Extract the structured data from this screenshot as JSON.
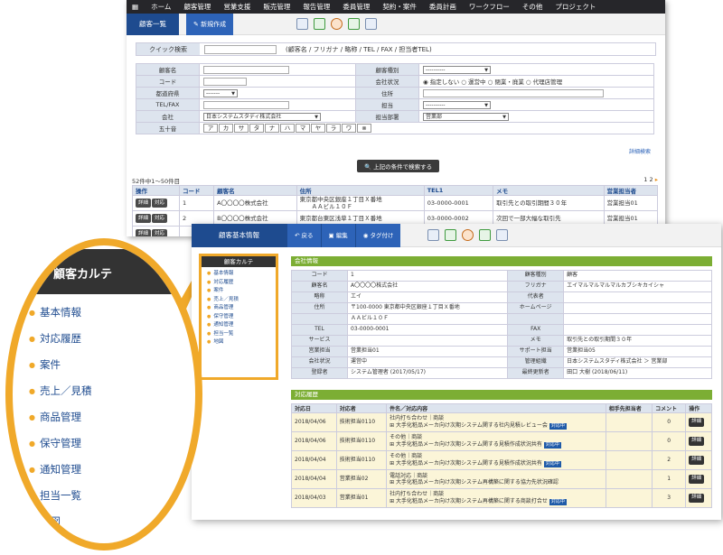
{
  "nav": [
    "ホーム",
    "顧客管理",
    "営業支援",
    "販売管理",
    "報告管理",
    "委員管理",
    "契約・案件",
    "委員計画",
    "ワークフロー",
    "その他",
    "プロジェクト"
  ],
  "list": {
    "title": "顧客一覧",
    "new_label": "新規作成",
    "quick": {
      "label": "クイック検索",
      "hint": "(顧客名 / フリガナ / 略称 / TEL / FAX / 担当者TEL)"
    },
    "form": {
      "name": "顧客名",
      "type": "顧客種別",
      "type_val": "----------",
      "code": "コード",
      "status": "会社状況",
      "status_opts": [
        "指定しない",
        "運営中",
        "閉業・廃業",
        "代理店管理"
      ],
      "pref": "都道府県",
      "pref_val": "-------",
      "addr": "住所",
      "telfax": "TEL/FAX",
      "rep": "担当",
      "rep_val": "----------",
      "company": "会社",
      "company_val": "日本システムスタディ株式会社",
      "dept": "担当部署",
      "dept_val": "営業部",
      "gojuon": "五十音",
      "kana": [
        "ア",
        "カ",
        "サ",
        "タ",
        "ナ",
        "ハ",
        "マ",
        "ヤ",
        "ラ",
        "ワ"
      ]
    },
    "detail_search": "詳細検索",
    "search_btn": "上記の条件で検索する",
    "count": "52件中1～50件目",
    "pages": [
      "1",
      "2"
    ],
    "cols": [
      "操作",
      "コード",
      "顧客名",
      "住所",
      "TEL1",
      "メモ",
      "営業担当者"
    ],
    "btn_detail": "詳細",
    "btn_resp": "対応",
    "rows": [
      {
        "code": "1",
        "name": "A〇〇〇〇株式会社",
        "addr1": "東京都中央区銀座１丁目Ｘ番地",
        "addr2": "ＡＡビル１０Ｆ",
        "tel": "03-0000-0001",
        "memo": "取引先との取引期間３０年",
        "rep": "営業担当01"
      },
      {
        "code": "2",
        "name": "B〇〇〇〇株式会社",
        "addr1": "東京都台東区浅草１丁目Ｘ番地",
        "addr2": "",
        "tel": "03-0000-0002",
        "memo": "次回で一部大幅な取引先",
        "rep": "営業担当01"
      },
      {
        "code": "",
        "name": "",
        "addr1": "",
        "addr2": "",
        "tel": "",
        "memo": "",
        "rep": ""
      },
      {
        "code": "",
        "name": "",
        "addr1": "",
        "addr2": "",
        "tel": "",
        "memo": "",
        "rep": ""
      }
    ]
  },
  "karte": {
    "title": "顧客基本情報",
    "back": "戻る",
    "edit": "編集",
    "tag": "タグ付け",
    "side_title": "顧客カルテ",
    "side_items": [
      "基本情報",
      "対応履歴",
      "案件",
      "売上／見積",
      "商品管理",
      "保守管理",
      "通知管理",
      "担当一覧",
      "地図"
    ],
    "company_section": "会社情報",
    "info": [
      [
        "コード",
        "1",
        "顧客種別",
        "顧客"
      ],
      [
        "顧客名",
        "A〇〇〇〇株式会社",
        "フリガナ",
        "エイマルマルマルマルカブシキカイシャ"
      ],
      [
        "略称",
        "エイ",
        "代表者",
        ""
      ],
      [
        "住所",
        "〒100-0000 東京都中央区銀座１丁目Ｘ番地",
        "ホームページ",
        ""
      ],
      [
        "",
        "ＡＡビル１０Ｆ",
        "",
        ""
      ],
      [
        "TEL",
        "03-0000-0001",
        "FAX",
        ""
      ],
      [
        "サービス",
        "",
        "メモ",
        "取引先との取引期間３０年"
      ],
      [
        "営業担当",
        "営業担当01",
        "サポート担当",
        "営業担当05"
      ],
      [
        "会社状況",
        "運営中",
        "管理組織",
        "日本システムスタディ株式会社 ＞ 営業部"
      ],
      [
        "登録者",
        "システム管理者 (2017/05/17)",
        "最終更新者",
        "田口 大樹 (2018/06/11)"
      ]
    ],
    "log_section": "対応履歴",
    "log_cols": [
      "対応日",
      "対応者",
      "件名／対応内容",
      "相手先担当者",
      "コメント",
      "操作"
    ],
    "log_detail": "詳細",
    "logs": [
      {
        "date": "2018/04/06",
        "who": "技術担当0110",
        "sub": "社内打ち合わせ｜商談",
        "body": "大手化粧品メーカ向け次期システム関する社内見積レビュー会",
        "tag": "対応中",
        "cmt": "0"
      },
      {
        "date": "2018/04/06",
        "who": "技術担当0110",
        "sub": "その他｜商談",
        "body": "大手化粧品メーカ向け次期システム関する見積作成状況共有",
        "tag": "対応中",
        "cmt": "0"
      },
      {
        "date": "2018/04/04",
        "who": "技術担当0110",
        "sub": "その他｜商談",
        "body": "大手化粧品メーカ向け次期システム関する見積作成状況共有",
        "tag": "対応中",
        "cmt": "2"
      },
      {
        "date": "2018/04/04",
        "who": "営業担当02",
        "sub": "電話対応｜商談",
        "body": "大手化粧品メーカ向け次期システム再構築に関する協力先状況確認",
        "tag": "",
        "cmt": "1"
      },
      {
        "date": "2018/04/03",
        "who": "営業担当01",
        "sub": "社内打ち合わせ｜商談",
        "body": "大手化粧品メーカ向け次期システム再構築に関する商談打合せ",
        "tag": "対応中",
        "cmt": "3"
      }
    ]
  }
}
